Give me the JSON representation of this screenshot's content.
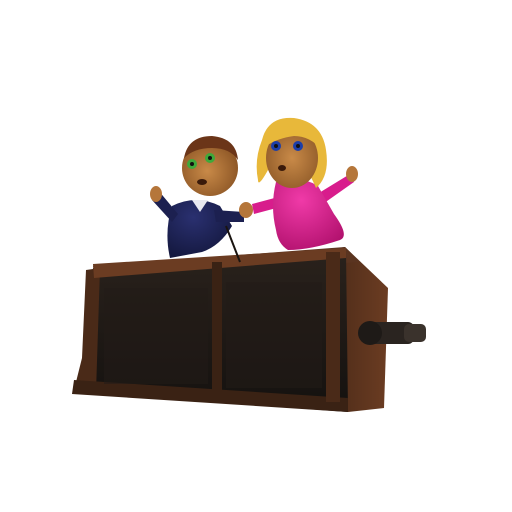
{
  "scene": {
    "background_color": "#ffffff",
    "objects": [
      "wooden-music-box",
      "crank-handle",
      "boy-figurine",
      "girl-figurine"
    ]
  },
  "colors": {
    "wood_dark": "#3a2214",
    "wood_mid": "#5a3420",
    "wood_light": "#7a4a2c",
    "box_panel": "#1e1a17",
    "crank_metal": "#2a2420",
    "skin": "#b5763a",
    "boy_hair": "#6b3518",
    "boy_suit": "#1c2050",
    "boy_eyes": "#3fa83a",
    "girl_hair": "#e8b83a",
    "girl_dress": "#d81c8c",
    "girl_eyes": "#1c3ea8"
  }
}
